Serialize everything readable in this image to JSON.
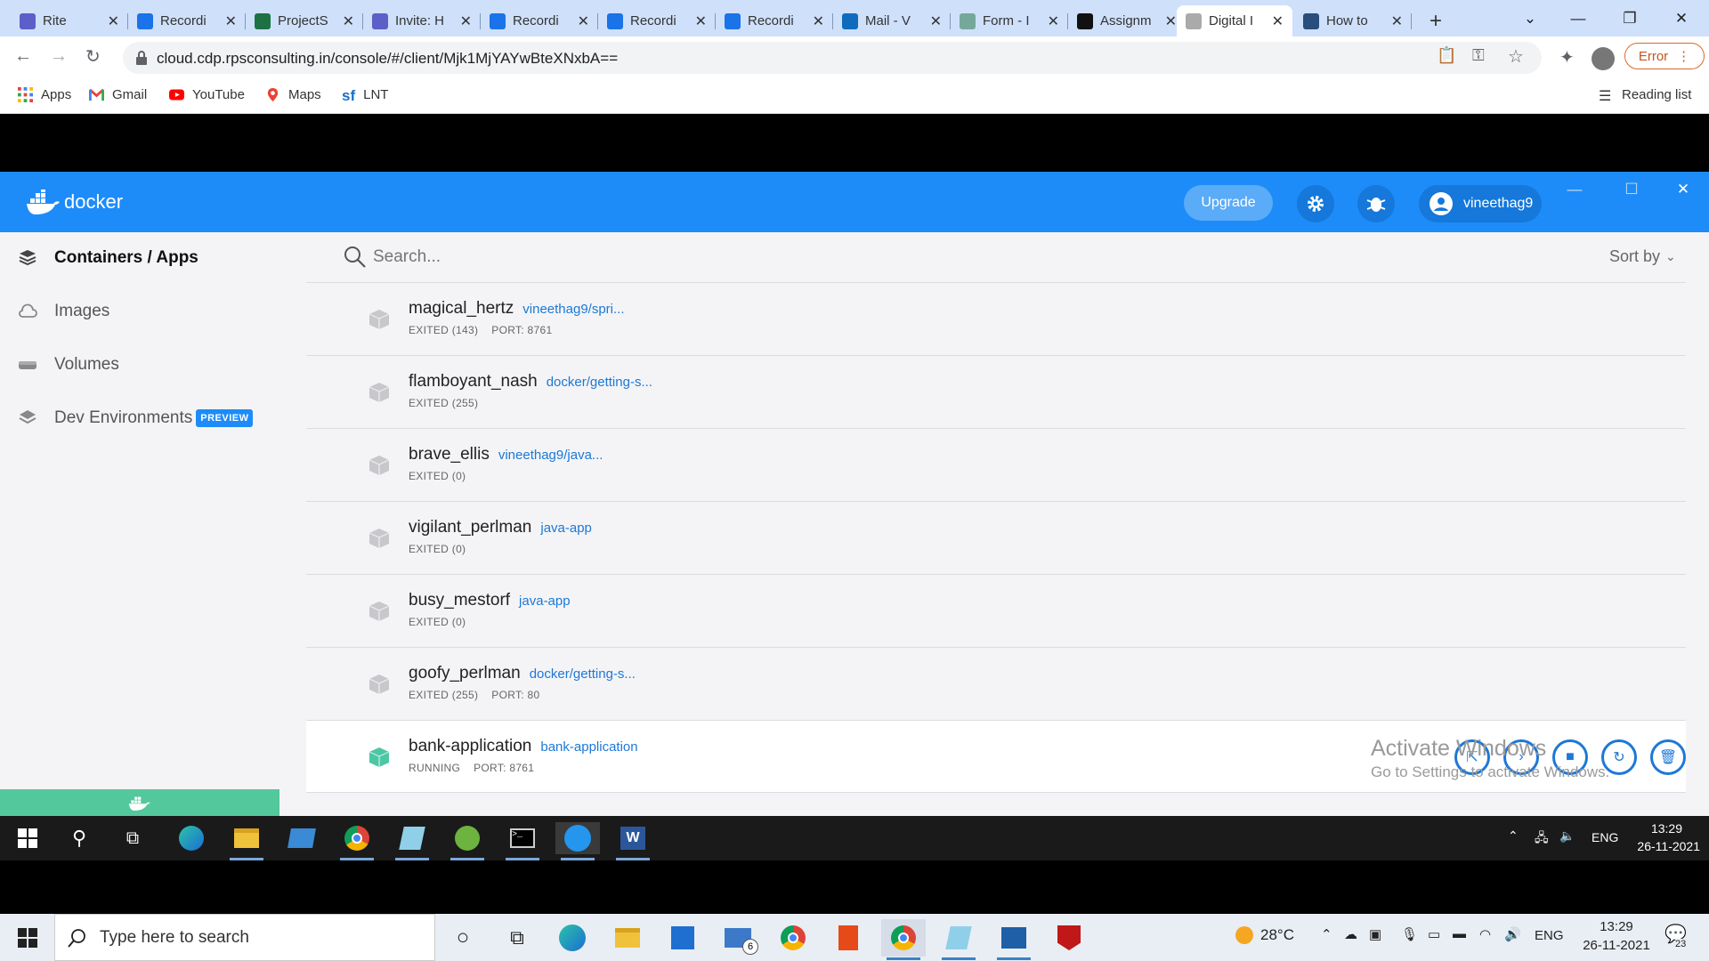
{
  "browser": {
    "tabs": [
      {
        "title": "Rite",
        "color": "#5b5fc7"
      },
      {
        "title": "Recordi",
        "color": "#1a73e8"
      },
      {
        "title": "ProjectS",
        "color": "#1e7145"
      },
      {
        "title": "Invite: H",
        "color": "#5b5fc7"
      },
      {
        "title": "Recordi",
        "color": "#1a73e8"
      },
      {
        "title": "Recordi",
        "color": "#1a73e8"
      },
      {
        "title": "Recordi",
        "color": "#1a73e8"
      },
      {
        "title": "Mail - V",
        "color": "#0f6cbd"
      },
      {
        "title": "Form - I",
        "color": "#76a89a"
      },
      {
        "title": "Assignm",
        "color": "#111111"
      },
      {
        "title": "Digital I",
        "color": "#aaaaaa"
      },
      {
        "title": "How to",
        "color": "#2a4d7b"
      }
    ],
    "url": "cloud.cdp.rpsconsulting.in/console/#/client/Mjk1MjYAYwBteXNxbA==",
    "error_label": "Error",
    "bookmarks": [
      {
        "label": "Apps",
        "icon": "apps-grid-icon"
      },
      {
        "label": "Gmail",
        "icon": "gmail-icon"
      },
      {
        "label": "YouTube",
        "icon": "youtube-icon"
      },
      {
        "label": "Maps",
        "icon": "maps-icon"
      },
      {
        "label": "LNT",
        "icon": "sf-icon"
      }
    ],
    "reading_list": "Reading list"
  },
  "docker": {
    "logo_text": "docker",
    "upgrade_label": "Upgrade",
    "username": "vineethag9",
    "sidebar": [
      {
        "label": "Containers / Apps",
        "active": true
      },
      {
        "label": "Images",
        "active": false
      },
      {
        "label": "Volumes",
        "active": false
      },
      {
        "label": "Dev Environments",
        "active": false
      }
    ],
    "preview_badge": "PREVIEW",
    "search_placeholder": "Search...",
    "sort_label": "Sort by",
    "containers": [
      {
        "name": "magical_hertz",
        "image": "vineethag9/spri...",
        "status": "EXITED (143)",
        "port": "PORT: 8761",
        "running": false
      },
      {
        "name": "flamboyant_nash",
        "image": "docker/getting-s...",
        "status": "EXITED (255)",
        "port": "",
        "running": false
      },
      {
        "name": "brave_ellis",
        "image": "vineethag9/java...",
        "status": "EXITED (0)",
        "port": "",
        "running": false
      },
      {
        "name": "vigilant_perlman",
        "image": "java-app",
        "status": "EXITED (0)",
        "port": "",
        "running": false
      },
      {
        "name": "busy_mestorf",
        "image": "java-app",
        "status": "EXITED (0)",
        "port": "",
        "running": false
      },
      {
        "name": "goofy_perlman",
        "image": "docker/getting-s...",
        "status": "EXITED (255)",
        "port": "PORT: 80",
        "running": false
      },
      {
        "name": "bank-application",
        "image": "bank-application",
        "status": "RUNNING",
        "port": "PORT: 8761",
        "running": true
      }
    ],
    "watermark": {
      "line1": "Activate Windows",
      "line2": "Go to Settings to activate Windows."
    }
  },
  "inner_taskbar": {
    "time": "13:29",
    "date": "26-11-2021",
    "lang": "ENG"
  },
  "outer_taskbar": {
    "search_placeholder": "Type here to search",
    "temperature": "28°C",
    "lang": "ENG",
    "time": "13:29",
    "date": "26-11-2021",
    "notifications": "23",
    "mail_badge": "6"
  }
}
